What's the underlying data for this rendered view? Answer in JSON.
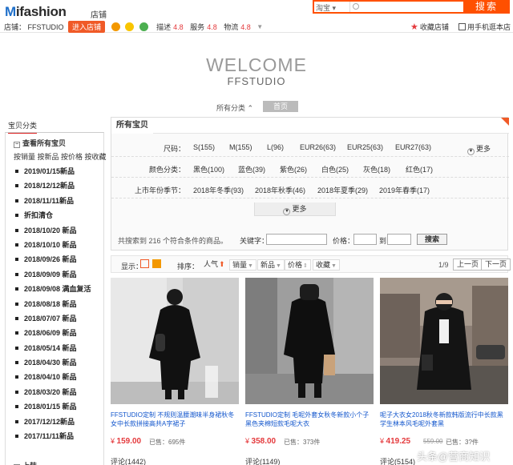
{
  "header": {
    "logo": "ifashion",
    "store_tag": "店铺",
    "store_label": "店铺：",
    "store_name": "FFSTUDIO",
    "enter_label": "进入店铺",
    "ratings": [
      {
        "label": "描述",
        "score": "4.8"
      },
      {
        "label": "服务",
        "score": "4.8"
      },
      {
        "label": "物流",
        "score": "4.8"
      }
    ],
    "search_scope": "淘宝",
    "search_placeholder": "",
    "search_button": "搜索",
    "favorite_label": "收藏店铺",
    "mobile_label": "用手机逛本店"
  },
  "hero": {
    "welcome": "WELCOME",
    "brand": "FFSTUDIO",
    "all_categories": "所有分类",
    "home_label": "首页"
  },
  "sidebar": {
    "tab": "宝贝分类",
    "all": "查看所有宝贝",
    "sort_links": "按销量 按新品 按价格 按收藏",
    "items": [
      "2019/01/15新品",
      "2018/12/12新品",
      "2018/11/11新品",
      "折扣清仓",
      "2018/10/20 新品",
      "2018/10/10 新品",
      "2018/09/26 新品",
      "2018/09/09 新品",
      "2018/09/08 满血复活",
      "2018/08/18 新品",
      "2018/07/07 新品",
      "2018/06/09 新品",
      "2018/05/14 新品",
      "2018/04/30 新品",
      "2018/04/10 新品",
      "2018/03/20 新品",
      "2018/01/15 新品",
      "2017/12/12新品",
      "2017/11/11新品"
    ],
    "more": "上装"
  },
  "filters": {
    "title": "所有宝贝",
    "rows": [
      {
        "label": "尺码：",
        "values": [
          "S(155)",
          "M(155)",
          "L(96)",
          "EUR26(63)",
          "EUR25(63)",
          "EUR27(63)"
        ],
        "more": "更多"
      },
      {
        "label": "颜色分类：",
        "values": [
          "黑色(100)",
          "蓝色(39)",
          "紫色(26)",
          "白色(25)",
          "灰色(18)",
          "红色(17)"
        ]
      },
      {
        "label": "上市年份季节：",
        "values": [
          "2018年冬季(93)",
          "2018年秋季(46)",
          "2018年夏季(29)",
          "2019年春季(17)"
        ]
      }
    ],
    "more_tab": "更多",
    "found_text": "共搜索到 216 个符合条件的商品。",
    "keyword_label": "关键字：",
    "keyword_value": "",
    "price_label": "价格：",
    "price_min": "",
    "price_max": "",
    "to_label": "到",
    "search_button": "搜索"
  },
  "sortbar": {
    "display_label": "显示：",
    "sort_label": "排序：",
    "sorts": [
      "人气",
      "销量",
      "新品",
      "价格",
      "收藏"
    ],
    "page_count": "1/9",
    "prev": "上一页",
    "next": "下一页"
  },
  "products": [
    {
      "title": "FFSTUDIO定制 不规则温腰潮味半身裙秋冬女中长款拼接高共A字裙子",
      "currency": "¥",
      "price": "159.00",
      "sold_label": "已售：",
      "sold": "695件",
      "review": "评论(1442)"
    },
    {
      "title": "FFSTUDIO定制 毛呢外套女秋冬新款小个子黑色夹棉短款毛呢大衣",
      "currency": "¥",
      "price": "358.00",
      "sold_label": "已售：",
      "sold": "373件",
      "review": "评论(1149)"
    },
    {
      "title": "呢子大衣女2018秋冬新款韩版流行中长款黑学生林本风毛呢外套黑",
      "currency": "¥",
      "price": "419.25",
      "old_price": "559.00",
      "sold_label": "已售：",
      "sold": "3?件",
      "review": "评论(5154)"
    }
  ],
  "watermark": "头条@营商知识",
  "colors": {
    "accent": "#ff5000",
    "price": "#e4393c",
    "link": "#1155cc"
  }
}
